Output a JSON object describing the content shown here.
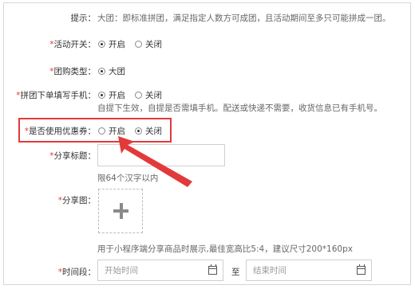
{
  "tip": {
    "label": "提示：",
    "text": "大团：即标准拼团，满足指定人数方可成团，且活动期间至多只可能拼成一团。"
  },
  "activity_switch": {
    "label": "活动开关：",
    "options": [
      "开启",
      "关闭"
    ],
    "selected": "开启"
  },
  "group_type": {
    "label": "团购类型：",
    "options": [
      "大团"
    ],
    "selected": "大团"
  },
  "phone_required": {
    "label": "拼团下单填写手机：",
    "options": [
      "开启",
      "关闭"
    ],
    "selected": "开启",
    "hint": "自提下生效，自提是否需填手机。配送或快递不需要，收货信息已有手机号。"
  },
  "use_coupon": {
    "label": "是否使用优惠券：",
    "options": [
      "开启",
      "关闭"
    ],
    "selected": "关闭"
  },
  "share_title": {
    "label": "分享标题：",
    "value": "",
    "hint": "限64个汉字以内"
  },
  "share_image": {
    "label": "分享图：",
    "hint": "用于小程序端分享商品时展示,最佳宽高比5:4，建议尺寸200*160px"
  },
  "time_range": {
    "label": "时间段：",
    "start_placeholder": "开始时间",
    "separator": "至",
    "end_placeholder": "结束时间"
  },
  "colors": {
    "highlight": "#e23a3a",
    "required_star": "#e4393c"
  },
  "icons": [
    "plus-icon",
    "calendar-icon",
    "arrow-annotation"
  ]
}
